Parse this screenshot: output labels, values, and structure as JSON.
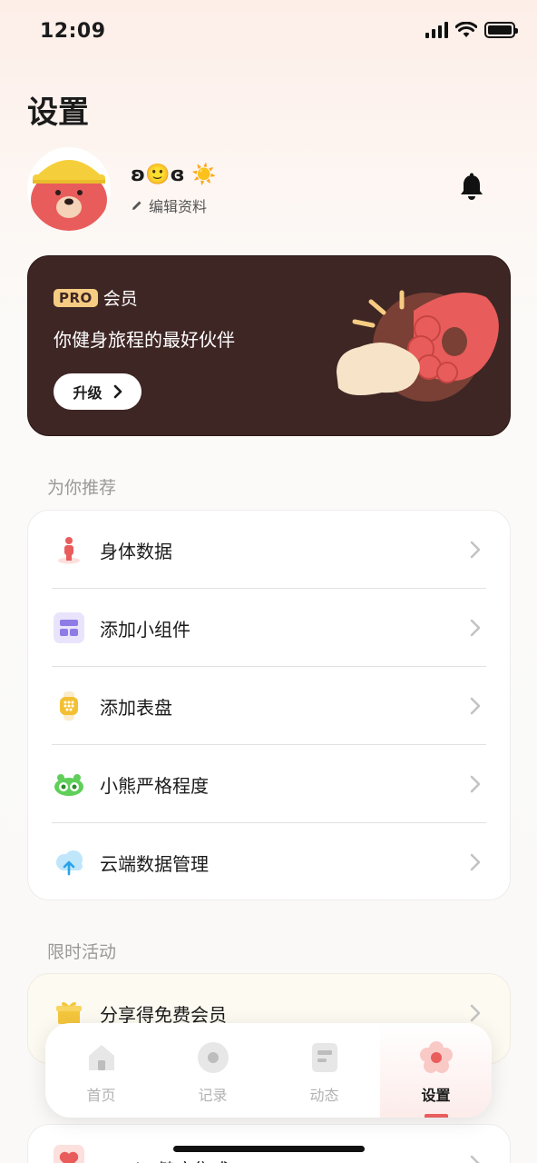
{
  "status": {
    "time": "12:09"
  },
  "page": {
    "title": "设置"
  },
  "profile": {
    "name_emoji": "ʚ🙂ɞ ☀️",
    "edit_label": "编辑资料"
  },
  "pro": {
    "badge": "PRO",
    "member": "会员",
    "tagline": "你健身旅程的最好伙伴",
    "upgrade": "升级"
  },
  "recommend": {
    "title": "为你推荐",
    "items": [
      {
        "label": "身体数据",
        "icon": "body-data-icon"
      },
      {
        "label": "添加小组件",
        "icon": "widget-icon"
      },
      {
        "label": "添加表盘",
        "icon": "watch-face-icon"
      },
      {
        "label": "小熊严格程度",
        "icon": "bear-strictness-icon"
      },
      {
        "label": "云端数据管理",
        "icon": "cloud-upload-icon"
      }
    ]
  },
  "promo": {
    "title": "限时活动",
    "items": [
      {
        "label": "分享得免费会员",
        "icon": "gift-icon"
      }
    ]
  },
  "tabs": [
    {
      "label": "首页",
      "icon": "home-icon",
      "active": false
    },
    {
      "label": "记录",
      "icon": "record-icon",
      "active": false
    },
    {
      "label": "动态",
      "icon": "feed-icon",
      "active": false
    },
    {
      "label": "设置",
      "icon": "settings-flower-icon",
      "active": true
    }
  ],
  "bottom": {
    "label": "Apple 健康集成",
    "icon": "heart-icon"
  },
  "colors": {
    "accent": "#e95d5d",
    "pro_card": "#3e2624",
    "pro_badge": "#f6cc83"
  }
}
